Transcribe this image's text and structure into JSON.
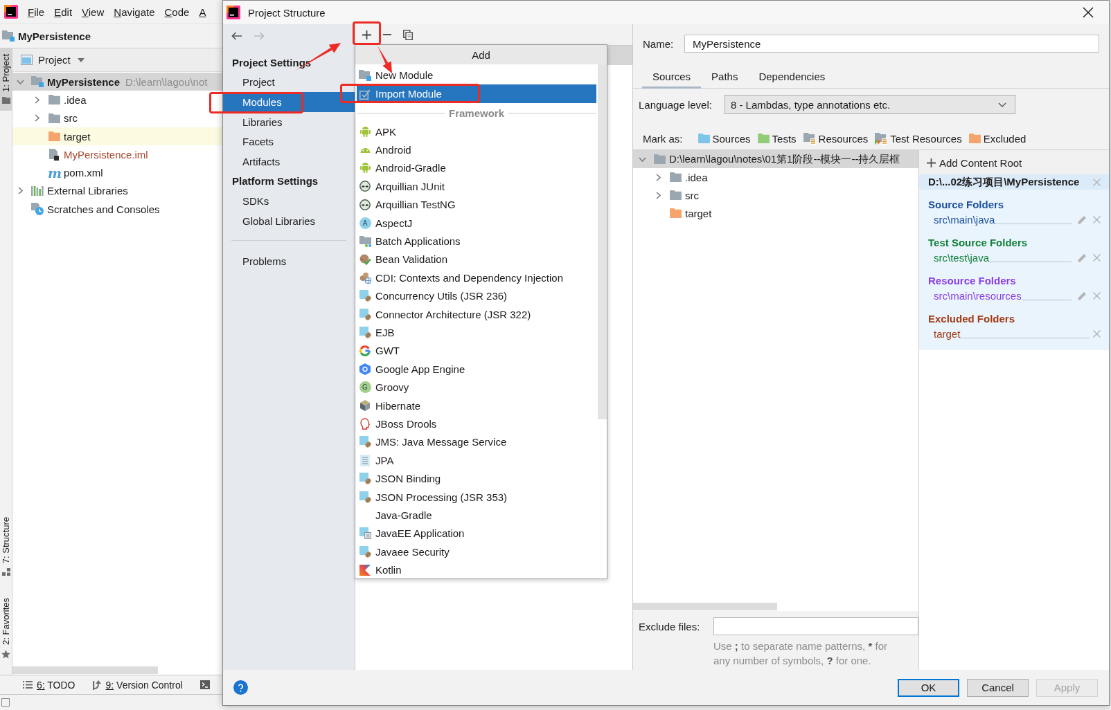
{
  "ide": {
    "menu": [
      "File",
      "Edit",
      "View",
      "Navigate",
      "Code",
      "A"
    ],
    "breadcrumb": "MyPersistence",
    "stripe": [
      {
        "kind": "project",
        "label": "1: Project",
        "selected": true
      },
      {
        "kind": "structure",
        "label": "7: Structure",
        "selected": false
      },
      {
        "kind": "favorites",
        "label": "2: Favorites",
        "selected": false
      }
    ],
    "project_panel": {
      "title": "Project",
      "tree": [
        {
          "kind": "module",
          "label": "MyPersistence",
          "path": "D:\\learn\\lagou\\not",
          "color": "#1b1b1b",
          "selected": true,
          "highlighted": false,
          "expanded": true,
          "children": [
            {
              "kind": "folder",
              "label": ".idea",
              "color": "#1b1b1b",
              "selected": false,
              "highlighted": false,
              "expanded": false
            },
            {
              "kind": "folder",
              "label": "src",
              "color": "#1b1b1b",
              "selected": false,
              "highlighted": false,
              "expanded": false
            },
            {
              "kind": "excluded",
              "label": "target",
              "color": "#1b1b1b",
              "selected": false,
              "highlighted": true
            },
            {
              "kind": "iml",
              "label": "MyPersistence.iml",
              "color": "#a4482c",
              "selected": false,
              "highlighted": false
            },
            {
              "kind": "pom",
              "glyph": "m",
              "label": "pom.xml",
              "color": "#1b1b1b",
              "selected": false,
              "highlighted": false
            }
          ]
        },
        {
          "kind": "libraries",
          "label": "External Libraries",
          "color": "#1b1b1b",
          "selected": false,
          "highlighted": false,
          "expanded": false
        },
        {
          "kind": "scratches",
          "label": "Scratches and Consoles",
          "color": "#1b1b1b",
          "selected": false,
          "highlighted": false
        }
      ]
    },
    "tool_windows": [
      {
        "kind": "todo",
        "label": "6: TODO"
      },
      {
        "kind": "vcs",
        "label": "9: Version Control"
      },
      {
        "kind": "terminal"
      }
    ]
  },
  "dialog": {
    "title": "Project Structure",
    "sidebar": [
      {
        "heading": "Project Settings",
        "items": [
          {
            "label": "Project",
            "selected": false
          },
          {
            "label": "Modules",
            "selected": true
          },
          {
            "label": "Libraries",
            "selected": false
          },
          {
            "label": "Facets",
            "selected": false
          },
          {
            "label": "Artifacts",
            "selected": false
          }
        ]
      },
      {
        "heading": "Platform Settings",
        "items": [
          {
            "label": "SDKs",
            "selected": false
          },
          {
            "label": "Global Libraries",
            "selected": false
          }
        ]
      },
      {
        "items": [
          {
            "label": "Problems",
            "selected": false
          }
        ]
      }
    ],
    "add_popup": {
      "title": "Add",
      "items": [
        {
          "kind": "new-module",
          "label": "New Module",
          "selected": false
        },
        {
          "kind": "import",
          "label": "Import Module",
          "selected": true
        }
      ],
      "section": "Framework",
      "frameworks": [
        {
          "kind": "android",
          "label": "APK",
          "selected": false
        },
        {
          "kind": "android-head",
          "label": "Android",
          "selected": false
        },
        {
          "kind": "android",
          "label": "Android-Gradle",
          "selected": false
        },
        {
          "kind": "alien",
          "label": "Arquillian JUnit",
          "selected": false
        },
        {
          "kind": "alien",
          "label": "Arquillian TestNG",
          "selected": false
        },
        {
          "kind": "letter",
          "badge": "A",
          "color": "#8fd0ea",
          "label": "AspectJ",
          "selected": false
        },
        {
          "kind": "folder-dots",
          "label": "Batch Applications",
          "selected": false
        },
        {
          "kind": "bean-check",
          "label": "Bean Validation",
          "selected": false
        },
        {
          "kind": "bean-globe",
          "label": "CDI: Contexts and Dependency Injection",
          "selected": false
        },
        {
          "kind": "javaee",
          "label": "Concurrency Utils (JSR 236)",
          "selected": false
        },
        {
          "kind": "javaee",
          "label": "Connector Architecture (JSR 322)",
          "selected": false
        },
        {
          "kind": "javaee",
          "label": "EJB",
          "selected": false
        },
        {
          "kind": "google",
          "label": "GWT",
          "selected": false
        },
        {
          "kind": "hexagon",
          "label": "Google App Engine",
          "selected": false
        },
        {
          "kind": "letter",
          "badge": "G",
          "color": "#a3cf8a",
          "label": "Groovy",
          "selected": false
        },
        {
          "kind": "hibernate",
          "label": "Hibernate",
          "selected": false
        },
        {
          "kind": "drools",
          "label": "JBoss Drools",
          "selected": false
        },
        {
          "kind": "javaee",
          "label": "JMS: Java Message Service",
          "selected": false
        },
        {
          "kind": "document",
          "label": "JPA",
          "selected": false
        },
        {
          "kind": "javaee",
          "label": "JSON Binding",
          "selected": false
        },
        {
          "kind": "javaee",
          "label": "JSON Processing (JSR 353)",
          "selected": false
        },
        {
          "kind": "plain",
          "label": "Java-Gradle",
          "selected": false
        },
        {
          "kind": "javaee-app",
          "label": "JavaEE Application",
          "selected": false
        },
        {
          "kind": "javaee",
          "label": "Javaee Security",
          "selected": false
        },
        {
          "kind": "kotlin",
          "label": "Kotlin",
          "selected": false
        }
      ]
    },
    "module": {
      "name_label": "Name:",
      "name": "MyPersistence",
      "tabs": [
        {
          "label": "Sources",
          "selected": true
        },
        {
          "label": "Paths",
          "selected": false
        },
        {
          "label": "Dependencies",
          "selected": false
        }
      ],
      "language_level": {
        "label": "Language level:",
        "value": "8 - Lambdas, type annotations etc."
      },
      "mark_as": {
        "label": "Mark as:",
        "items": [
          {
            "kind": "sources",
            "label": "Sources"
          },
          {
            "kind": "tests",
            "label": "Tests"
          },
          {
            "kind": "resources",
            "label": "Resources"
          },
          {
            "kind": "test-resources",
            "label": "Test Resources"
          },
          {
            "kind": "excluded",
            "label": "Excluded"
          }
        ]
      },
      "tree": [
        {
          "kind": "folder",
          "label": "D:\\learn\\lagou\\notes\\01第1阶段--模块一--持久层框",
          "selected": true,
          "expanded": true,
          "children": [
            {
              "kind": "folder",
              "label": ".idea",
              "selected": false,
              "expanded": false
            },
            {
              "kind": "folder",
              "label": "src",
              "selected": false,
              "expanded": false
            },
            {
              "kind": "excluded",
              "label": "target",
              "selected": false
            }
          ]
        }
      ],
      "exclude_files": {
        "label": "Exclude files:",
        "hint": [
          {
            "text": "Use ",
            "bold": false
          },
          {
            "text": ";",
            "bold": true
          },
          {
            "text": " to separate name patterns, ",
            "bold": false
          },
          {
            "text": "*",
            "bold": true
          },
          {
            "text": " for any number of symbols, ",
            "bold": false
          },
          {
            "text": "?",
            "bold": true
          },
          {
            "text": " for one.",
            "bold": false
          }
        ]
      }
    },
    "content_root": {
      "add_label": "Add Content Root",
      "root": "D:\\...02练习项目\\MyPersistence",
      "sections": [
        {
          "title": "Source Folders",
          "color": "#1b4f9c",
          "folders": [
            {
              "path": "src\\main\\java",
              "editable": true
            }
          ]
        },
        {
          "title": "Test Source Folders",
          "color": "#12803a",
          "folders": [
            {
              "path": "src\\test\\java",
              "editable": true
            }
          ]
        },
        {
          "title": "Resource Folders",
          "color": "#8a3ee6",
          "folders": [
            {
              "path": "src\\main\\resources",
              "editable": true
            }
          ]
        },
        {
          "title": "Excluded Folders",
          "color": "#a23a12",
          "folders": [
            {
              "path": "target",
              "editable": false
            }
          ]
        }
      ]
    },
    "buttons": [
      {
        "label": "OK",
        "default": true,
        "disabled": false
      },
      {
        "label": "Cancel",
        "default": false,
        "disabled": false
      },
      {
        "label": "Apply",
        "default": false,
        "disabled": true
      }
    ]
  }
}
